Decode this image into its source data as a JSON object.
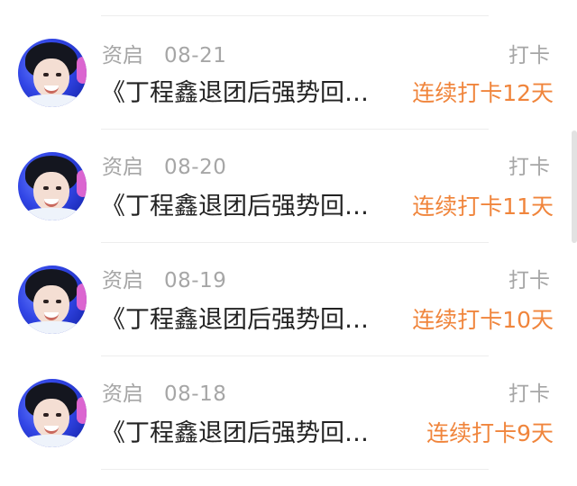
{
  "feed": {
    "items": [
      {
        "author": "资启",
        "date": "08-21",
        "tag": "打卡",
        "title": "《丁程鑫退团后强势回…",
        "streak": "连续打卡12天"
      },
      {
        "author": "资启",
        "date": "08-20",
        "tag": "打卡",
        "title": "《丁程鑫退团后强势回…",
        "streak": "连续打卡11天"
      },
      {
        "author": "资启",
        "date": "08-19",
        "tag": "打卡",
        "title": "《丁程鑫退团后强势回…",
        "streak": "连续打卡10天"
      },
      {
        "author": "资启",
        "date": "08-18",
        "tag": "打卡",
        "title": "《丁程鑫退团后强势回…",
        "streak": "连续打卡9天"
      }
    ]
  },
  "colors": {
    "accent": "#f0853c",
    "meta": "#a6a6a6",
    "title": "#222222",
    "divider": "#ededed"
  },
  "icons": {
    "avatar": "user-avatar-photo"
  }
}
